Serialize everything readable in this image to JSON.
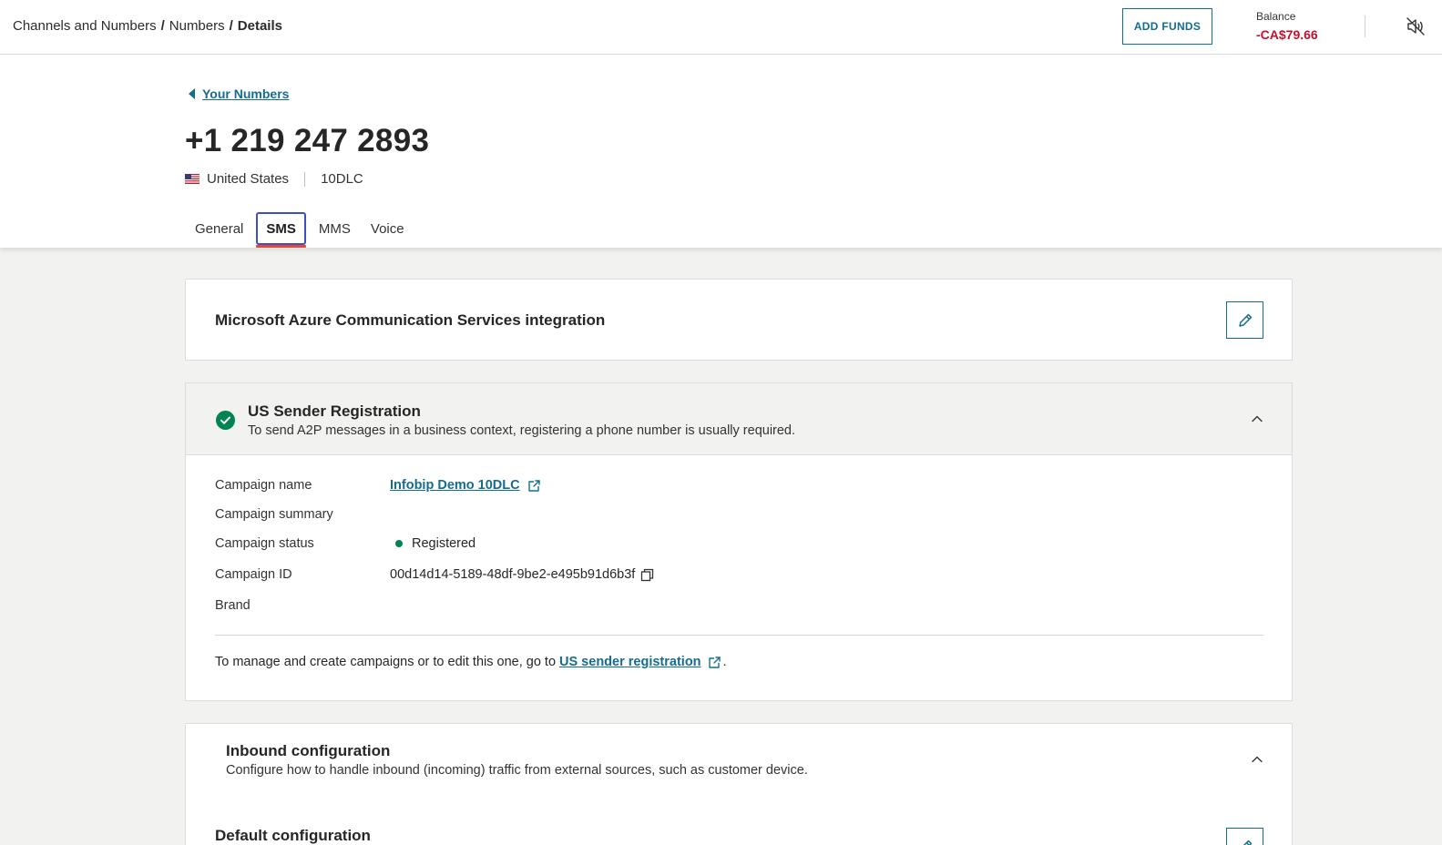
{
  "breadcrumb": {
    "item1": "Channels and Numbers",
    "sep1": "/",
    "item2": "Numbers",
    "sep2": "/",
    "current": "Details"
  },
  "topbar": {
    "add_funds_label": "ADD FUNDS",
    "balance_label": "Balance",
    "balance_value": "-CA$79.66",
    "balance_color": "#c8102e",
    "mute_icon": "speaker-muted-icon"
  },
  "header": {
    "back_label": "Your Numbers",
    "phone_number": "+1 219 247 2893",
    "country": "United States",
    "number_type": "10DLC",
    "tabs": [
      {
        "label": "General",
        "active": false
      },
      {
        "label": "SMS",
        "active": true
      },
      {
        "label": "MMS",
        "active": false
      },
      {
        "label": "Voice",
        "active": false
      }
    ]
  },
  "azure_card": {
    "title": "Microsoft Azure Communication Services integration",
    "edit_icon": "pencil-icon"
  },
  "sender_registration": {
    "title": "US Sender Registration",
    "subtitle": "To send A2P messages in a business context, registering a phone number is usually required.",
    "status_icon": "check-circle-icon",
    "status_icon_color": "#008451",
    "rows": {
      "campaign_name_label": "Campaign name",
      "campaign_name_value": "Infobip Demo 10DLC",
      "campaign_summary_label": "Campaign summary",
      "campaign_status_label": "Campaign status",
      "campaign_status_value": "Registered",
      "campaign_id_label": "Campaign ID",
      "campaign_id_value": "00d14d14-5189-48df-9be2-e495b91d6b3f",
      "brand_label": "Brand"
    },
    "footer_text": "To manage and create campaigns or to edit this one, go to",
    "footer_link": "US sender registration",
    "footer_end": "."
  },
  "inbound_card": {
    "title": "Inbound configuration",
    "subtitle": "Configure how to handle inbound (incoming) traffic from external sources, such as customer device."
  },
  "default_card": {
    "title": "Default configuration"
  },
  "colors": {
    "accent": "#146d8e",
    "active_tab_outline": "#3e4fc1",
    "active_tab_underline": "#e14a3b",
    "status_green": "#008451",
    "page_bg": "#f2f2f0"
  }
}
